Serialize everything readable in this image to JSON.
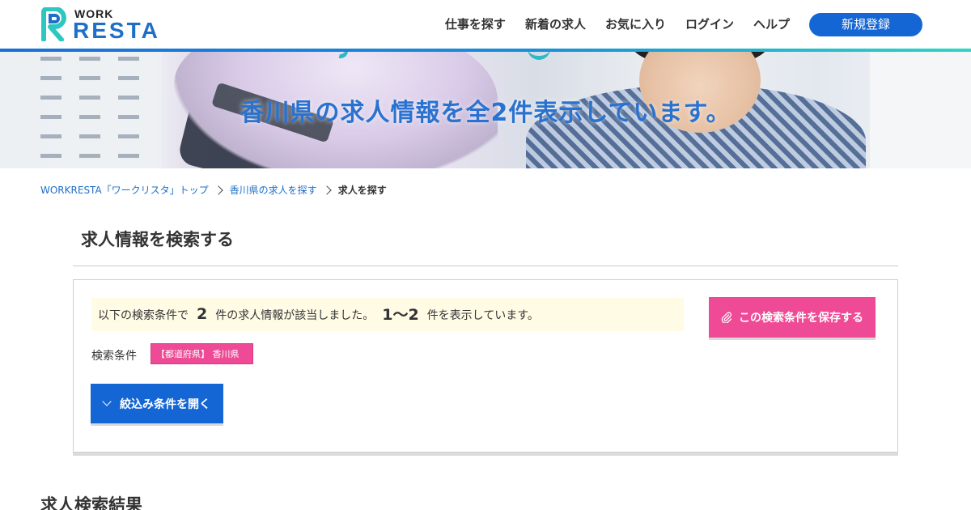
{
  "brand": {
    "logo_top": "WORK",
    "logo_main": "RESTA",
    "accent_blue": "#1466d4",
    "accent_pink": "#ee4a95",
    "accent_teal": "#2ed6c6"
  },
  "nav": {
    "items": [
      {
        "label": "仕事を探す"
      },
      {
        "label": "新着の求人"
      },
      {
        "label": "お気に入り"
      },
      {
        "label": "ログイン"
      },
      {
        "label": "ヘルプ"
      }
    ],
    "signup_label": "新規登録"
  },
  "hero": {
    "title": "香川県の求人情報を全2件表示しています。"
  },
  "breadcrumb": {
    "items": [
      {
        "label": "WORKRESTA「ワークリスタ」トップ"
      },
      {
        "label": "香川県の求人を探す"
      },
      {
        "label": "求人を探す"
      }
    ]
  },
  "search": {
    "section_title": "求人情報を検索する",
    "note_prefix": "以下の検索条件で",
    "total_count": "2",
    "note_middle": "件の求人情報が該当しました。",
    "range": "1～2",
    "note_suffix": "件を表示しています。",
    "save_label": "この検索条件を保存する",
    "conditions_label": "検索条件",
    "condition_tag": "【都道府県】 香川県",
    "filter_label": "絞込み条件を開く"
  },
  "results": {
    "title": "求人検索結果"
  }
}
